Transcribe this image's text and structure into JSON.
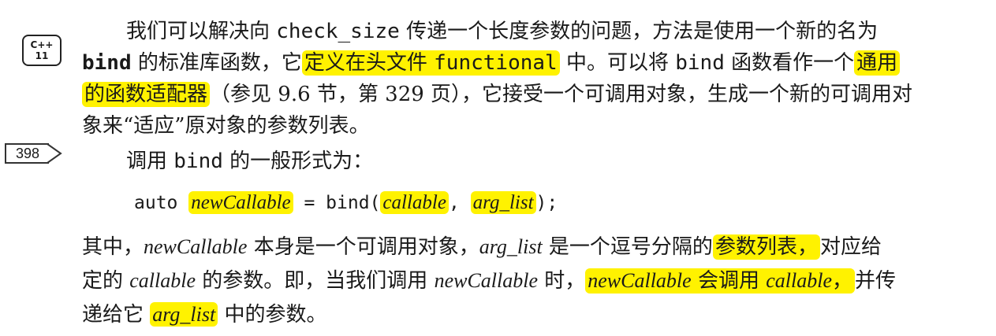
{
  "badge": {
    "line1": "C++",
    "line2": "11"
  },
  "page_marker": {
    "number": "398"
  },
  "paragraph1": {
    "l1_a": "我们可以解决向 ",
    "l1_code": "check_size",
    "l1_b": " 传递一个长度参数的问题，方法是使用一个新的名为",
    "l2_bind": "bind",
    "l2_a": " 的标准库函数，它",
    "l2_hl1a": "定义在头文件 ",
    "l2_hl1code": "functional",
    "l2_b": " 中。可以将 ",
    "l2_code": "bind",
    "l2_c": " 函数看作一个",
    "l2_hl2": "通用",
    "l3_hl": "的函数适配器",
    "l3_a": "（参见 9.6 节，第 329 页），它接受一个可调用对象，生成一个新的可调用对",
    "l4": "象来“适应”原对象的参数列表。"
  },
  "general_form": {
    "a": "调用 ",
    "code": "bind",
    "b": " 的一般形式为："
  },
  "code": {
    "auto": "auto ",
    "newCallable": "newCallable",
    "eq_bind": " = bind(",
    "callable": "callable",
    "comma": ", ",
    "arg_list": "arg_list",
    "end": ");"
  },
  "paragraph2": {
    "l1_a": "其中，",
    "l1_new": "newCallable",
    "l1_b": " 本身是一个可调用对象，",
    "l1_arg": "arg_list",
    "l1_c": " 是一个逗号分隔的",
    "l1_hl": "参数列表，",
    "l1_d": "对应给",
    "l2_a": "定的 ",
    "l2_callable": "callable",
    "l2_b": " 的参数。即，当我们调用 ",
    "l2_new": "newCallable",
    "l2_c": " 时，",
    "l2_hl_new": "newCallable",
    "l2_hl_mid": " 会调用 ",
    "l2_hl_callable": "callable",
    "l2_hl_end": "，",
    "l2_d": "并传",
    "l3_a": "递给它 ",
    "l3_hl": "arg_list",
    "l3_b": " 中的参数。"
  }
}
